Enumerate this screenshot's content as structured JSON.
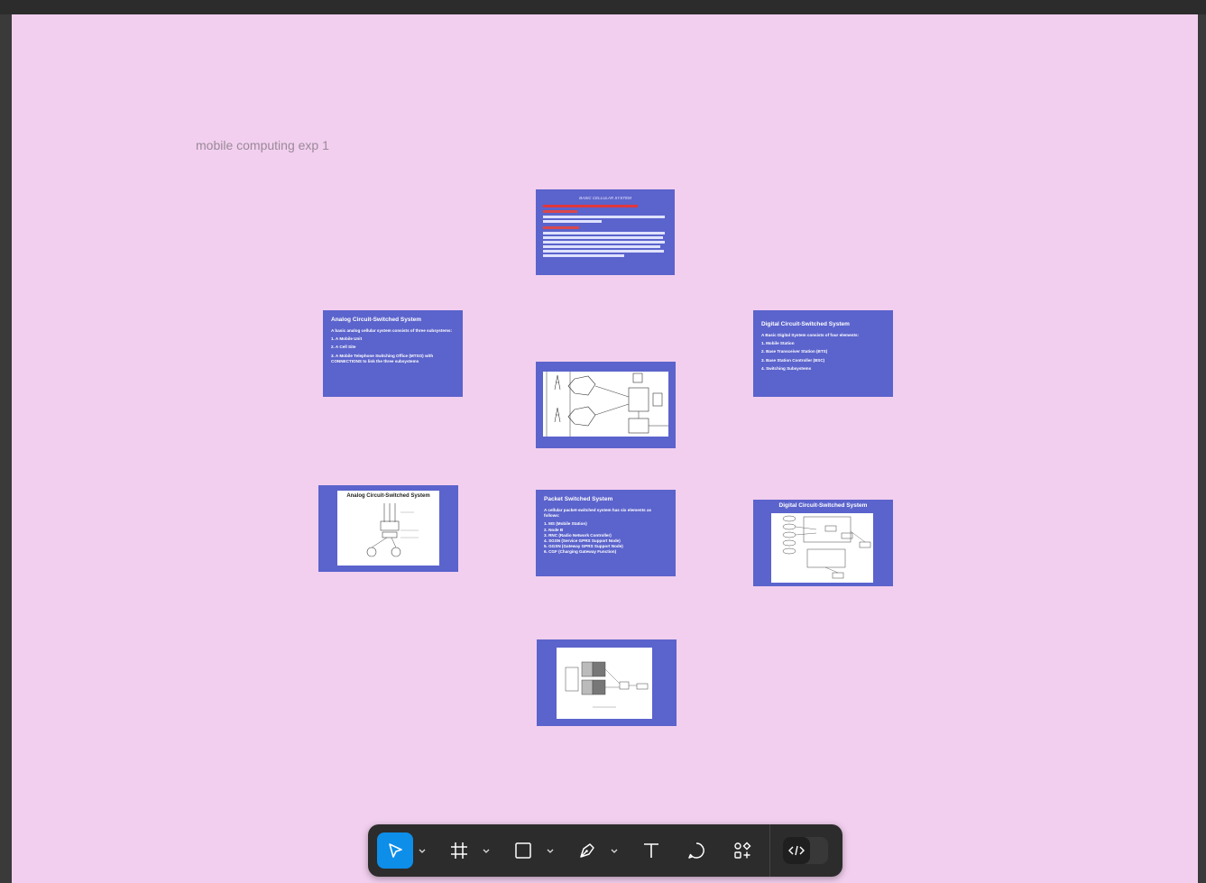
{
  "canvas": {
    "section_title": "mobile computing exp 1",
    "background": "#f2cfef"
  },
  "frames": {
    "basic": {
      "title": "BASIC CELLULAR SYSTEM"
    },
    "analog_text": {
      "title": "Analog Circuit-Switched System",
      "intro": "A basic analog cellular system consists of three subsystems:",
      "items": [
        "1. A Mobile Unit",
        "2. A Cell Site",
        "3. A Mobile Telephone Switching Office (MTSO) with CONNECTIONS to link the three subsystems"
      ]
    },
    "digital_text": {
      "title": "Digital Circuit-Switched System",
      "intro": "A Basic Digital System consists of four elements:",
      "items": [
        "1. Mobile Station",
        "2. Base Transceiver Station (BTS)",
        "3. Base Station Controller (BSC)",
        "4. Switching Subsystems"
      ]
    },
    "packet_text": {
      "title": "Packet Switched System",
      "intro": "A cellular packet-switched system has six elements as follows:",
      "items": [
        "1. MS (Mobile Station)",
        "2. Node B",
        "3. RNC (Radio Network Controller)",
        "4. SGSN (Service GPRS Support Node)",
        "5. GGSN (Gateway GPRS Support Node)",
        "6. CGF (Charging Gateway Function)"
      ]
    },
    "analog_image": {
      "title": "Analog Circuit-Switched System"
    },
    "digital_image": {
      "title": "Digital Circuit-Switched System"
    }
  },
  "toolbar": {
    "tools": [
      {
        "name": "move",
        "icon": "cursor-arrow-icon",
        "active": true
      },
      {
        "name": "frame",
        "icon": "hash-frame-icon"
      },
      {
        "name": "rectangle",
        "icon": "rectangle-icon"
      },
      {
        "name": "pen",
        "icon": "pen-icon"
      },
      {
        "name": "text",
        "icon": "text-icon"
      },
      {
        "name": "comment",
        "icon": "comment-icon"
      },
      {
        "name": "actions",
        "icon": "shapes-plus-icon"
      },
      {
        "name": "dev-mode",
        "icon": "code-icon"
      }
    ],
    "accent": "#0d8ee9"
  }
}
